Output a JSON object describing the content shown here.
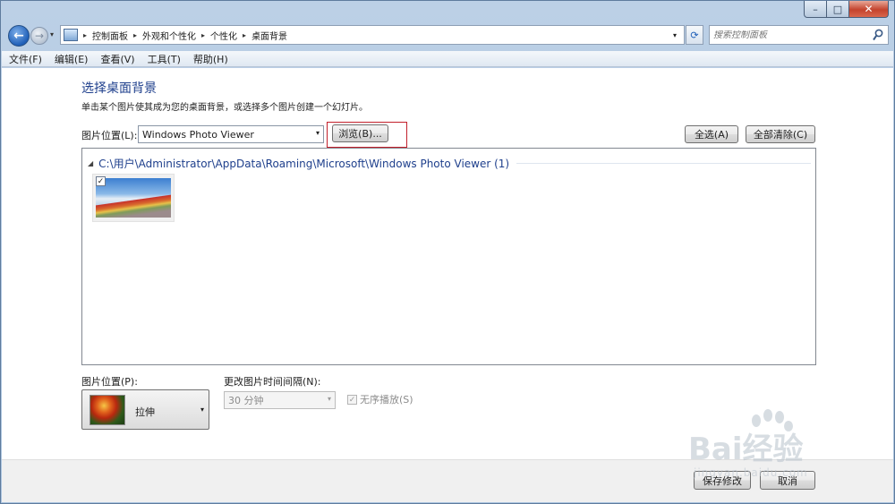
{
  "window": {
    "caption": {
      "minimize": "–",
      "maximize": "□",
      "close": "✕"
    }
  },
  "nav": {
    "back_glyph": "←",
    "forward_glyph": "→",
    "dropdown_glyph": "▾",
    "breadcrumb": [
      "控制面板",
      "外观和个性化",
      "个性化",
      "桌面背景"
    ],
    "crumb_separator": "▸",
    "refresh_glyph": "⟳",
    "search_placeholder": "搜索控制面板"
  },
  "menubar": {
    "items": [
      "文件(F)",
      "编辑(E)",
      "查看(V)",
      "工具(T)",
      "帮助(H)"
    ]
  },
  "main": {
    "title": "选择桌面背景",
    "subtitle": "单击某个图片使其成为您的桌面背景，或选择多个图片创建一个幻灯片。",
    "location_label": "图片位置(L):",
    "location_value": "Windows Photo Viewer",
    "browse_button": "浏览(B)...",
    "select_all_button": "全选(A)",
    "clear_all_button": "全部清除(C)",
    "group_toggle": "◢",
    "group_path": "C:\\用户\\Administrator\\AppData\\Roaming\\Microsoft\\Windows Photo Viewer (1)",
    "thumbnail_checked": "✓"
  },
  "position": {
    "label": "图片位置(P):",
    "value": "拉伸"
  },
  "interval": {
    "label": "更改图片时间间隔(N):",
    "value": "30 分钟"
  },
  "shuffle": {
    "label": "无序播放(S)",
    "check": "✓"
  },
  "buttons": {
    "save": "保存修改",
    "cancel": "取消"
  },
  "watermark": {
    "main": "Bai经验",
    "sub": "jingyan.baidu.com"
  },
  "colors": {
    "accent_blue": "#1e3f8c",
    "highlight_red": "#c2202c",
    "close_red": "#c4432d"
  }
}
